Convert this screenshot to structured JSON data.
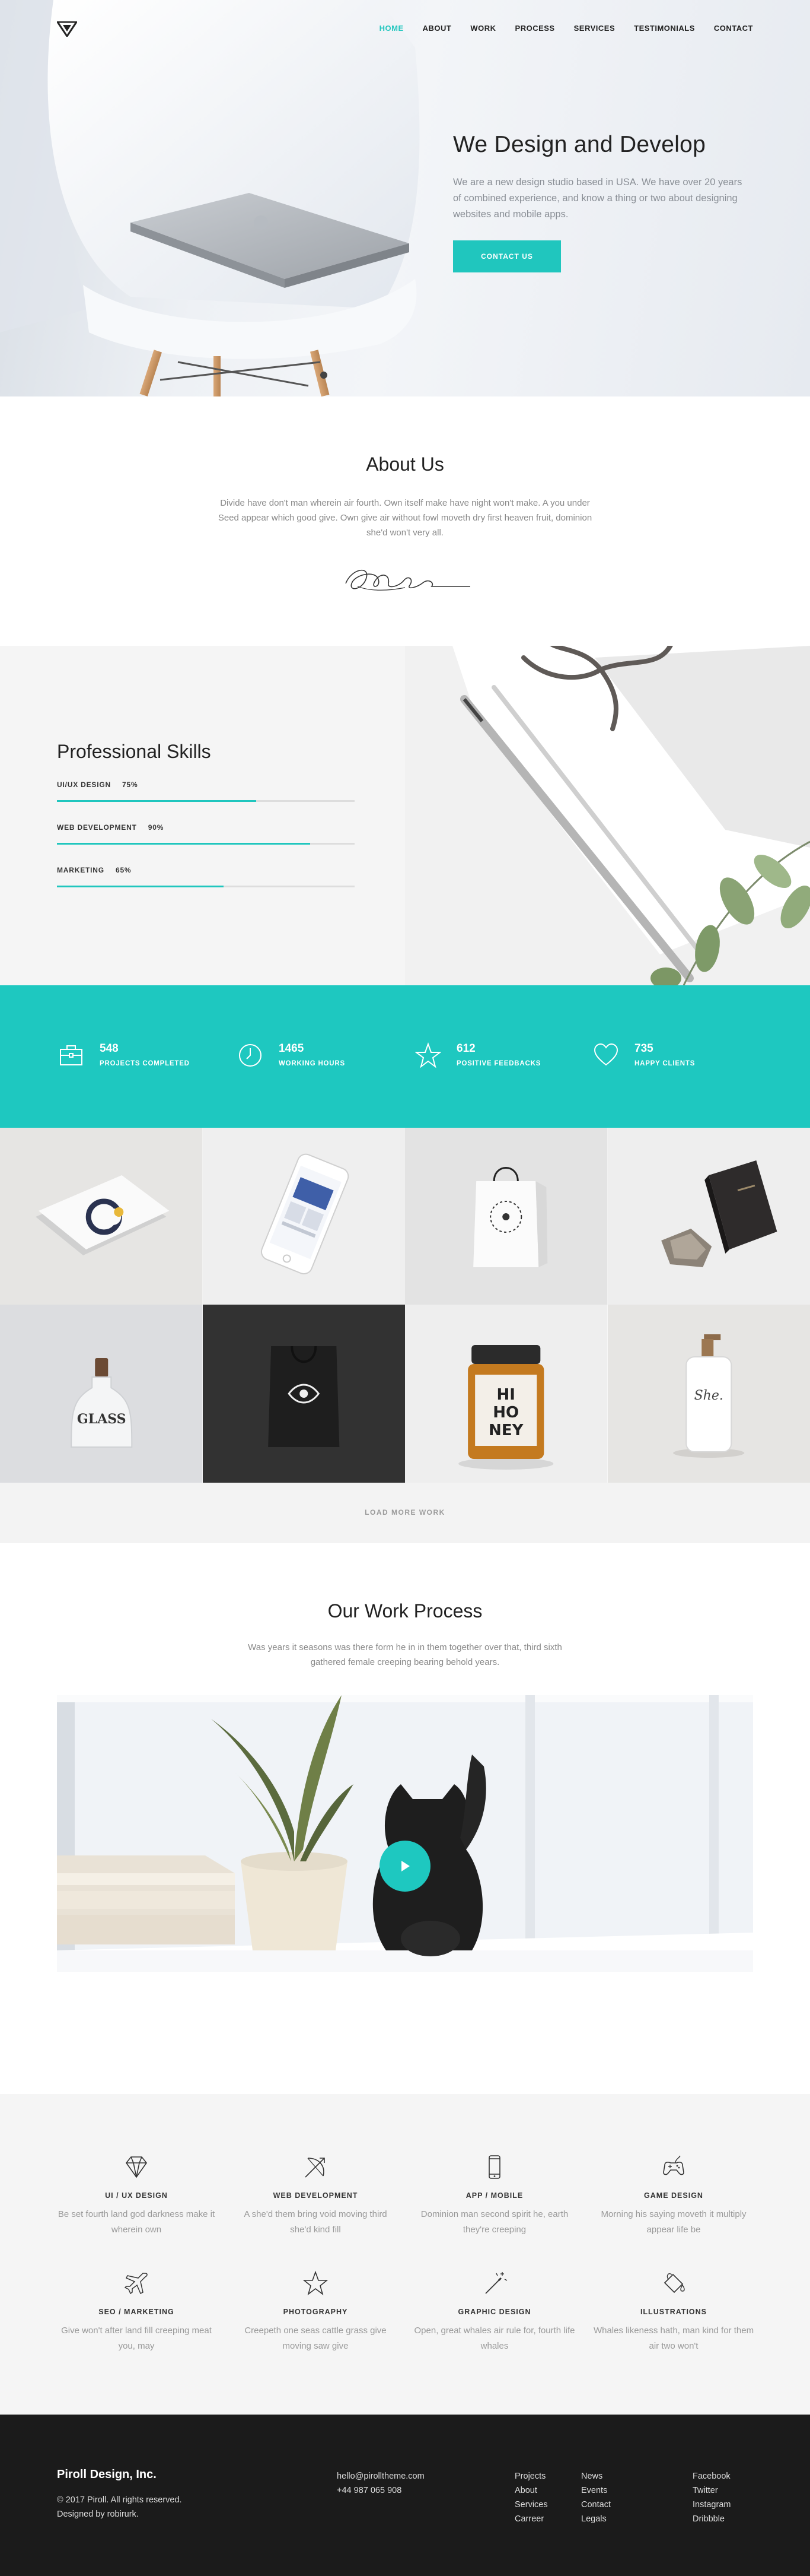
{
  "nav": {
    "items": [
      "HOME",
      "ABOUT",
      "WORK",
      "PROCESS",
      "SERVICES",
      "TESTIMONIALS",
      "CONTACT"
    ],
    "active": "HOME"
  },
  "hero": {
    "title": "We Design and Develop",
    "subtitle": "We are a new design studio based in USA. We have over 20 years of combined experience, and know a thing or two about designing websites and mobile apps.",
    "cta": "CONTACT US"
  },
  "about": {
    "title": "About Us",
    "text": "Divide have don't man wherein air fourth. Own itself make have night won't make. A you under Seed appear which good give. Own give air without fowl moveth dry first heaven fruit, dominion she'd won't very all."
  },
  "skills": {
    "title": "Professional Skills",
    "items": [
      {
        "label": "UI/UX DESIGN",
        "percent_text": "75%",
        "value": 0.67
      },
      {
        "label": "WEB DEVELOPMENT",
        "percent_text": "90%",
        "value": 0.85
      },
      {
        "label": "MARKETING",
        "percent_text": "65%",
        "value": 0.56
      }
    ]
  },
  "stats": [
    {
      "icon": "briefcase-icon",
      "number": "548",
      "label": "PROJECTS COMPLETED"
    },
    {
      "icon": "clock-icon",
      "number": "1465",
      "label": "WORKING HOURS"
    },
    {
      "icon": "star-icon",
      "number": "612",
      "label": "POSITIVE FEEDBACKS"
    },
    {
      "icon": "heart-icon",
      "number": "735",
      "label": "HAPPY CLIENTS"
    }
  ],
  "portfolio": {
    "load_more": "LOAD MORE WORK"
  },
  "process": {
    "title": "Our Work Process",
    "text": "Was years it seasons was there form he in in them together over that, third sixth gathered female creeping bearing behold years."
  },
  "services": [
    {
      "icon": "diamond-icon",
      "title": "UI / UX DESIGN",
      "text": "Be set fourth land god darkness make it wherein own"
    },
    {
      "icon": "bow-arrow-icon",
      "title": "WEB DEVELOPMENT",
      "text": "A she'd them bring void moving third she'd kind fill"
    },
    {
      "icon": "phone-icon",
      "title": "APP / MOBILE",
      "text": "Dominion man second spirit he, earth they're creeping"
    },
    {
      "icon": "gamepad-icon",
      "title": "GAME DESIGN",
      "text": "Morning his saying moveth it multiply appear life be"
    },
    {
      "icon": "plane-icon",
      "title": "SEO / MARKETING",
      "text": "Give won't after land fill creeping meat you, may"
    },
    {
      "icon": "star-outline-icon",
      "title": "PHOTOGRAPHY",
      "text": "Creepeth one seas cattle grass give moving saw give"
    },
    {
      "icon": "magic-wand-icon",
      "title": "GRAPHIC DESIGN",
      "text": "Open, great whales air rule for, fourth life whales"
    },
    {
      "icon": "paint-bucket-icon",
      "title": "ILLUSTRATIONS",
      "text": "Whales likeness hath, man kind for them air two won't"
    }
  ],
  "footer": {
    "brand": "Piroll Design, Inc.",
    "copyright": "© 2017 Piroll. All rights reserved.",
    "designed_by": "Designed by robirurk.",
    "email": "hello@pirolltheme.com",
    "phone": "+44 987 065 908",
    "col1": [
      "Projects",
      "About",
      "Services",
      "Carreer"
    ],
    "col2": [
      "News",
      "Events",
      "Contact",
      "Legals"
    ],
    "col3": [
      "Facebook",
      "Twitter",
      "Instagram",
      "Dribbble"
    ]
  },
  "colors": {
    "accent": "#20c6be",
    "footer_bg": "#1b1b1b",
    "section_bg": "#f5f5f5"
  }
}
